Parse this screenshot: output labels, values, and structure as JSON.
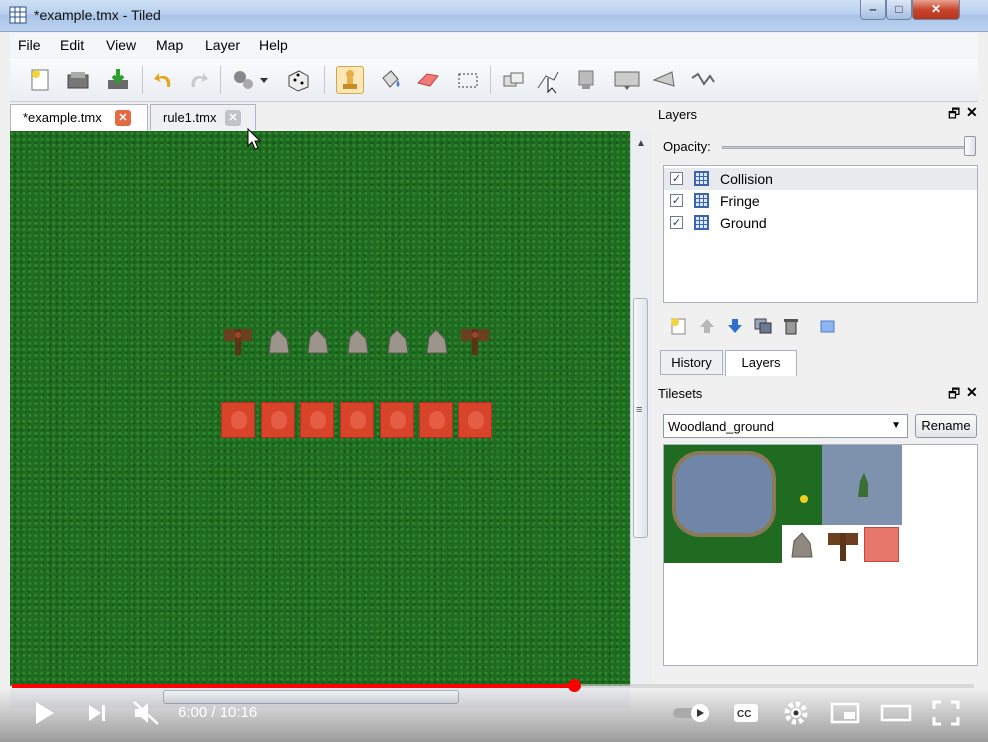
{
  "window": {
    "title": "*example.tmx - Tiled"
  },
  "menu": [
    "File",
    "Edit",
    "View",
    "Map",
    "Layer",
    "Help"
  ],
  "tabs": [
    {
      "label": "*example.tmx",
      "active": true
    },
    {
      "label": "rule1.tmx",
      "active": false
    }
  ],
  "layers_panel": {
    "title": "Layers",
    "opacity_label": "Opacity:",
    "layers": [
      {
        "name": "Collision",
        "checked": true,
        "selected": true
      },
      {
        "name": "Fringe",
        "checked": true
      },
      {
        "name": "Ground",
        "checked": true
      }
    ]
  },
  "bottom_tabs": [
    "History",
    "Layers"
  ],
  "tilesets_panel": {
    "title": "Tilesets",
    "selected_tileset": "Woodland_ground",
    "rename_label": "Rename"
  },
  "player": {
    "time": "6:00 / 10:16",
    "progress": 0.584
  },
  "colors": {
    "grass": "#1f6b22",
    "collision": "#d8442a",
    "accent": "#ff0000"
  },
  "icons": [
    "new-map-icon",
    "open-icon",
    "save-icon",
    "undo-icon",
    "redo-icon",
    "command-icon",
    "dice-icon",
    "stamp-brush-icon",
    "bucket-fill-icon",
    "eraser-icon",
    "rect-select-icon",
    "magic-wand-icon",
    "select-objects-icon",
    "insert-tile-icon",
    "insert-rect-icon",
    "insert-polygon-icon",
    "insert-polyline-icon"
  ]
}
